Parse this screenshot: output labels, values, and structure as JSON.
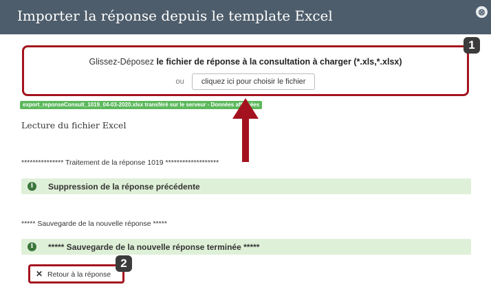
{
  "dialog": {
    "title": "Importer la réponse depuis le template Excel",
    "close_glyph": "⊗"
  },
  "dropzone": {
    "prefix": "Glissez-Déposez ",
    "bold_text": "le fichier de réponse à la consultation à charger (*.xls,*.xlsx)",
    "or_text": "ou",
    "choose_label": "cliquez ici pour choisir le fichier"
  },
  "upload_status": "export_reponseConsult_1019_04-03-2020.xlsx transféré sur le serveur - Données affichées",
  "log": {
    "lecture": "Lecture du fichier Excel",
    "traitement": "*************** Traitement de la réponse 1019 *******************",
    "alert1": "Suppression de la réponse précédente",
    "sauvegarde": "***** Sauvegarde de la nouvelle réponse *****",
    "alert2": "***** Sauvegarde de la nouvelle réponse terminée *****"
  },
  "back_button": {
    "icon": "✕",
    "label": "Retour à la réponse"
  },
  "annotations": {
    "badge1": "1",
    "badge2": "2"
  },
  "colors": {
    "header_bg": "#4e5d6b",
    "highlight_red": "#a3121e",
    "success_green": "#5cb85c",
    "alert_bg": "#dff0d8"
  },
  "icons": {
    "close": "close-icon",
    "info": "info-icon",
    "back": "x-icon",
    "arrow": "arrow-up-icon"
  }
}
